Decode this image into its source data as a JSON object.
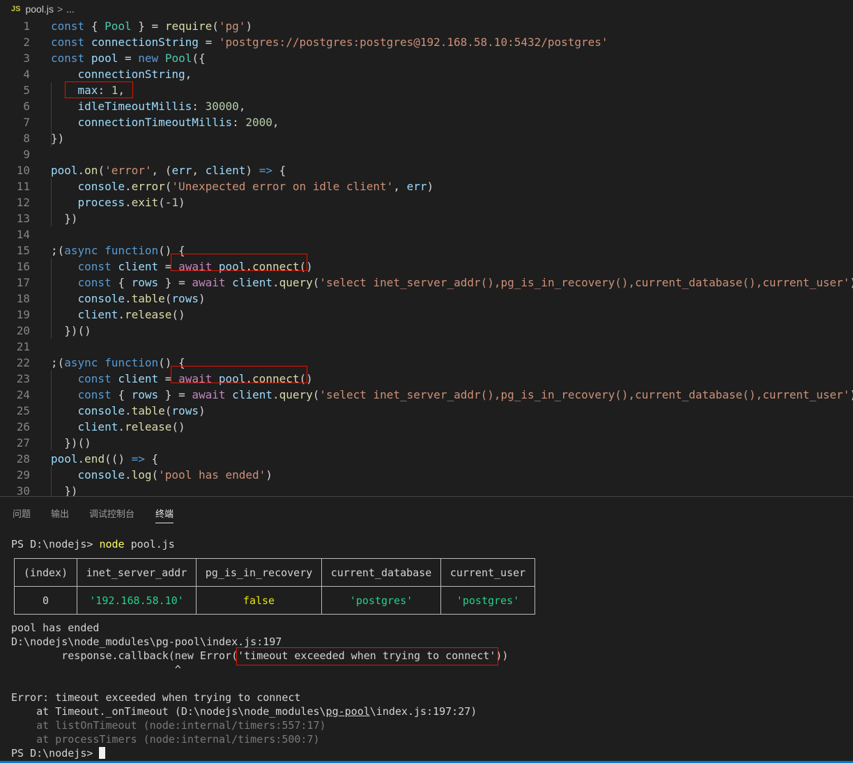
{
  "breadcrumb": {
    "icon": "JS",
    "file": "pool.js",
    "separator": ">",
    "trail": "..."
  },
  "editor": {
    "line_numbers": [
      "1",
      "2",
      "3",
      "4",
      "5",
      "6",
      "7",
      "8",
      "9",
      "10",
      "11",
      "12",
      "13",
      "14",
      "15",
      "16",
      "17",
      "18",
      "19",
      "20",
      "21",
      "22",
      "23",
      "24",
      "25",
      "26",
      "27",
      "28",
      "29",
      "30"
    ],
    "code": {
      "l1": [
        "const",
        "{",
        "Pool",
        "}",
        "=",
        "require",
        "(",
        "'pg'",
        ")"
      ],
      "l2": [
        "const",
        "connectionString",
        "=",
        "'postgres://postgres:postgres@192.168.58.10:5432/postgres'"
      ],
      "l3": [
        "const",
        "pool",
        "=",
        "new",
        "Pool",
        "({"
      ],
      "l4": [
        "connectionString",
        ","
      ],
      "l5": [
        "max",
        ":",
        "1",
        ","
      ],
      "l6": [
        "idleTimeoutMillis",
        ":",
        "30000",
        ","
      ],
      "l7": [
        "connectionTimeoutMillis",
        ":",
        "2000",
        ","
      ],
      "l8": [
        "})"
      ],
      "l10": [
        "pool",
        ".",
        "on",
        "(",
        "'error'",
        ",",
        "(",
        "err",
        ",",
        "client",
        ")",
        "=>",
        "{"
      ],
      "l11": [
        "console",
        ".",
        "error",
        "(",
        "'Unexpected error on idle client'",
        ",",
        "err",
        ")"
      ],
      "l12": [
        "process",
        ".",
        "exit",
        "(-",
        "1",
        ")"
      ],
      "l13": [
        "})"
      ],
      "l15": [
        ";(",
        "async",
        "function",
        "()",
        "{"
      ],
      "l16": [
        "const",
        "client",
        "=",
        "await",
        "pool",
        ".",
        "connect",
        "()"
      ],
      "l17": [
        "const",
        "{",
        "rows",
        "}",
        "=",
        "await",
        "client",
        ".",
        "query",
        "(",
        "'select inet_server_addr(),pg_is_in_recovery(),current_database(),current_user'",
        ")"
      ],
      "l18": [
        "console",
        ".",
        "table",
        "(",
        "rows",
        ")"
      ],
      "l19": [
        "client",
        ".",
        "release",
        "()"
      ],
      "l20": [
        "})()"
      ],
      "l22": [
        ";(",
        "async",
        "function",
        "()",
        "{"
      ],
      "l23": [
        "const",
        "client",
        "=",
        "await",
        "pool",
        ".",
        "connect",
        "()"
      ],
      "l24": [
        "const",
        "{",
        "rows",
        "}",
        "=",
        "await",
        "client",
        ".",
        "query",
        "(",
        "'select inet_server_addr(),pg_is_in_recovery(),current_database(),current_user'",
        ")"
      ],
      "l25": [
        "console",
        ".",
        "table",
        "(",
        "rows",
        ")"
      ],
      "l26": [
        "client",
        ".",
        "release",
        "()"
      ],
      "l27": [
        "})()"
      ],
      "l28": [
        "pool",
        ".",
        "end",
        "((",
        ")",
        "=>",
        "{"
      ],
      "l29": [
        "console",
        ".",
        "log",
        "(",
        "'pool has ended'",
        ")"
      ],
      "l30": [
        "})"
      ]
    }
  },
  "panel": {
    "tabs": [
      "问题",
      "输出",
      "调试控制台",
      "终端"
    ],
    "active_tab": "终端",
    "terminal": {
      "prompt1": "PS D:\\nodejs> ",
      "command": "node",
      "command_args": " pool.js",
      "table_headers": [
        "(index)",
        "inet_server_addr",
        "pg_is_in_recovery",
        "current_database",
        "current_user"
      ],
      "table_row": [
        "0",
        "'192.168.58.10'",
        "false",
        "'postgres'",
        "'postgres'"
      ],
      "pool_ended": "pool has ended",
      "error_path": "D:\\nodejs\\node_modules\\pg-pool\\index.js:197",
      "callback_pre": "        response.callback(new Error(",
      "callback_msg": "'timeout exceeded when trying to connect'",
      "callback_post": "))",
      "caret": "                          ^",
      "error_line": "Error: timeout exceeded when trying to connect",
      "stack1_pre": "    at Timeout._onTimeout (D:\\nodejs\\node_modules\\",
      "stack1_link": "pg-pool",
      "stack1_post": "\\index.js:197:27)",
      "stack2": "    at listOnTimeout (node:internal/timers:557:17)",
      "stack3": "    at processTimers (node:internal/timers:500:7)",
      "prompt2": "PS D:\\nodejs> "
    }
  },
  "colors": {
    "highlight_box": "#e51400",
    "keyword": "#569cd6",
    "variable": "#9cdcfe",
    "string": "#ce9178",
    "class": "#4ec9b0",
    "function": "#dcdcaa",
    "number": "#b5cea8",
    "control": "#c586c0",
    "status_bar": "#007acc"
  }
}
